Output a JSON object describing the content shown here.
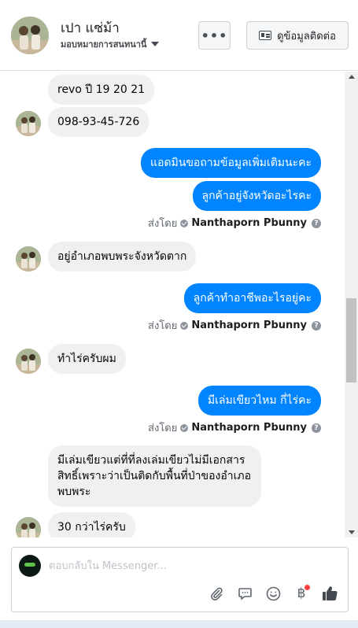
{
  "header": {
    "name": "เปา แซ่ม้า",
    "assign_label": "มอบหมายการสนทนานี้",
    "more_label": "•••",
    "contact_label": "ดูข้อมูลติดต่อ"
  },
  "messages": [
    {
      "from": "customer",
      "text": "revo ปี 19 20 21"
    },
    {
      "from": "customer",
      "text": "098-93-45-726"
    },
    {
      "from": "page",
      "text": "แอดมินขอถามข้อมูลเพิ่มเติมนะคะ"
    },
    {
      "from": "page",
      "text": "ลูกค้าอยู่จังหวัดอะไรคะ"
    },
    {
      "from": "customer",
      "text": "อยู่อำเภอพบพระจังหวัดตาก"
    },
    {
      "from": "page",
      "text": "ลูกค้าทำอาชีพอะไรอยู่คะ"
    },
    {
      "from": "customer",
      "text": "ทำไร่ครับผม"
    },
    {
      "from": "page",
      "text": "มีเล่มเขียวไหม กี่ไร่คะ"
    },
    {
      "from": "customer",
      "text": "มีเล่มเขียวแต่ที่ที่ลงเล่มเขียวไม่มีเอกสารสิทธิ์เพราะว่าเป็นติดกับพื้นที่ป่าของอำเภอพบพระ"
    },
    {
      "from": "customer",
      "text": "30 กว่าไร่ครับ"
    }
  ],
  "sent_by": {
    "prefix": "ส่งโดย",
    "name": "Nanthaporn Pbunny",
    "help": "?"
  },
  "composer": {
    "placeholder": "ตอบกลับใน Messenger..."
  },
  "icons": {
    "attach": "paperclip-icon",
    "quick_reply": "chat-bubble-icon",
    "emoji": "smiley-icon",
    "payment": "baht-icon",
    "like": "thumbs-up-icon"
  },
  "colors": {
    "outgoing_bubble": "#0084ff",
    "incoming_bubble": "#f0f0f0",
    "like_icon": "#444950",
    "notification_dot": "#fa3e3e"
  }
}
